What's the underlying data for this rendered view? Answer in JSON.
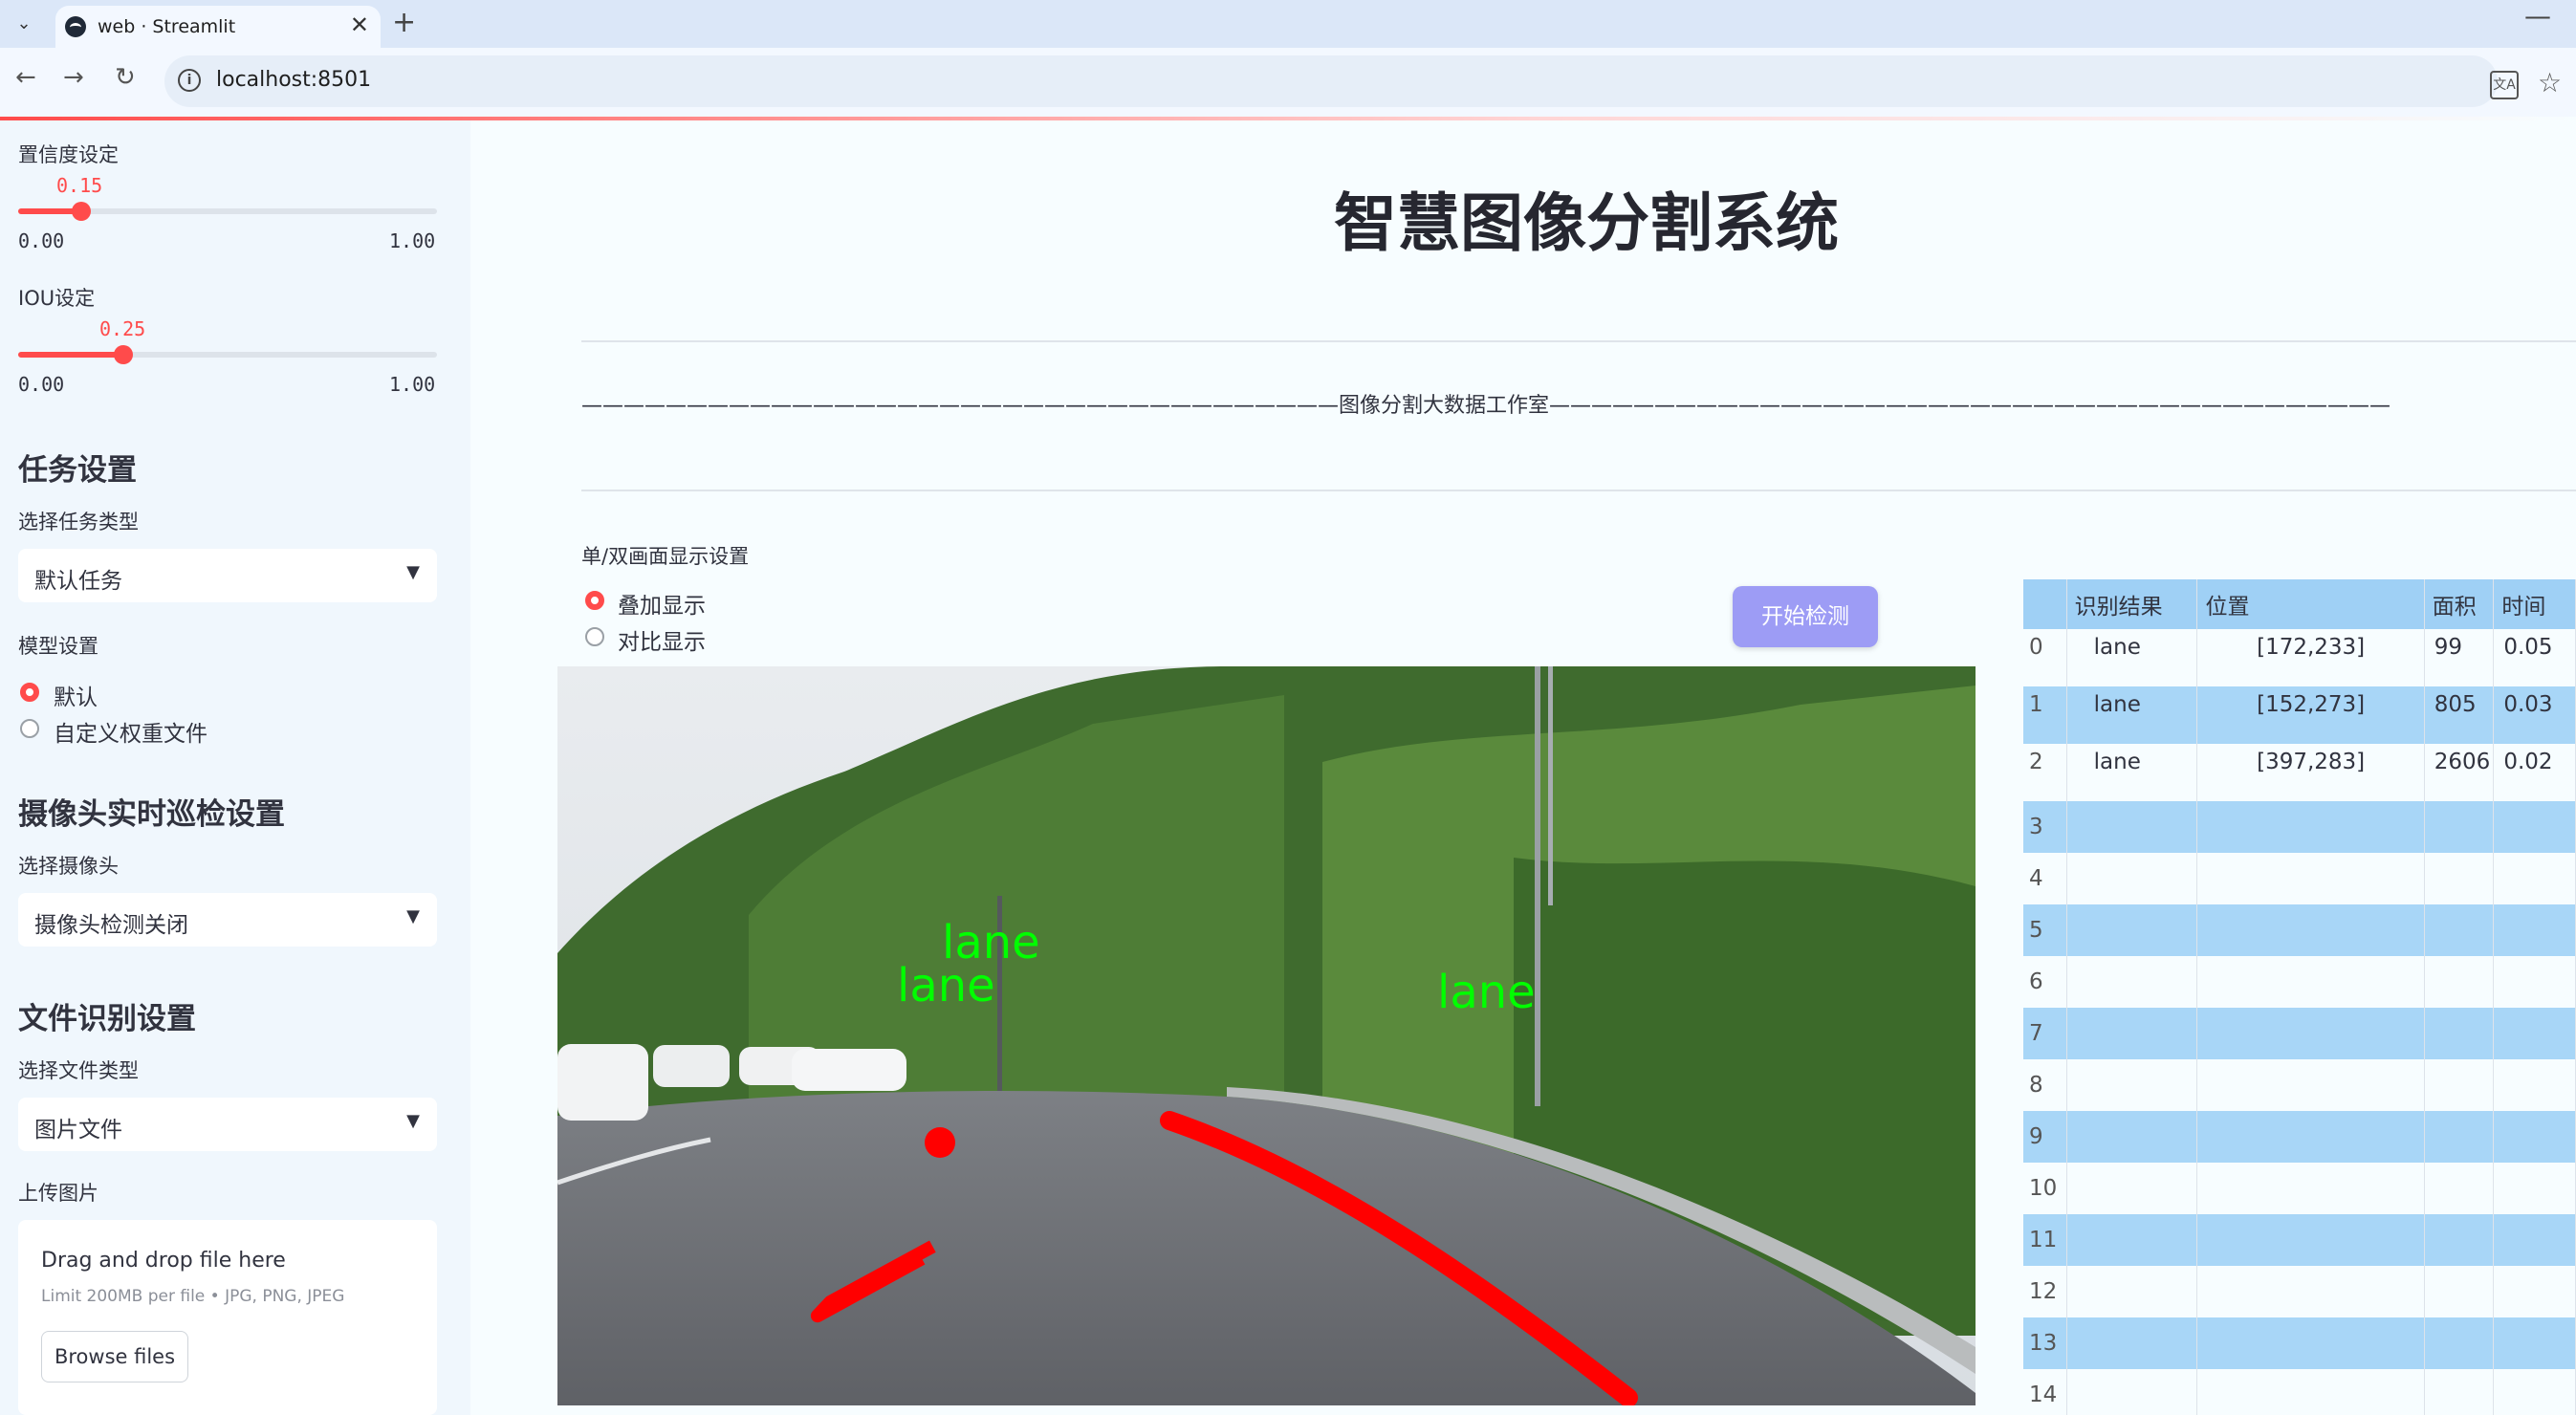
{
  "browser": {
    "tab_title": "web · Streamlit",
    "tab_close": "✕",
    "new_tab": "+",
    "minimize": "—",
    "url": "localhost:8501",
    "nav": {
      "back": "←",
      "forward": "→",
      "reload": "↻"
    }
  },
  "sidebar": {
    "confidence": {
      "label": "置信度设定",
      "value": "0.15",
      "value_fraction": 0.15,
      "min": "0.00",
      "max": "1.00"
    },
    "iou": {
      "label": "IOU设定",
      "value": "0.25",
      "value_fraction": 0.25,
      "min": "0.00",
      "max": "1.00"
    },
    "task_section": {
      "heading": "任务设置",
      "label": "选择任务类型",
      "selected": "默认任务"
    },
    "model_section": {
      "label": "模型设置",
      "options": [
        "默认",
        "自定义权重文件"
      ],
      "selected_index": 0
    },
    "camera_section": {
      "heading": "摄像头实时巡检设置",
      "label": "选择摄像头",
      "selected": "摄像头检测关闭"
    },
    "file_section": {
      "heading": "文件识别设置",
      "label": "选择文件类型",
      "selected": "图片文件"
    },
    "upload": {
      "label": "上传图片",
      "drop_text": "Drag and drop file here",
      "limit_text": "Limit 200MB per file • JPG, PNG, JPEG",
      "browse_label": "Browse files"
    }
  },
  "main": {
    "title": "智慧图像分割系统",
    "studio_line": "————————————————————————————————————图像分割大数据工作室————————————————————————————————————————",
    "display_setting": {
      "label": "单/双画面显示设置",
      "options": [
        "叠加显示",
        "对比显示"
      ],
      "selected_index": 0
    },
    "start_button": "开始检测",
    "detections": [
      "lane",
      "lane",
      "lane"
    ]
  },
  "results_table": {
    "headers": [
      "",
      "识别结果",
      "位置",
      "面积",
      "时间"
    ],
    "rows": [
      [
        "0",
        "lane",
        "[172,233]",
        "99",
        "0.05"
      ],
      [
        "1",
        "lane",
        "[152,273]",
        "805",
        "0.03"
      ],
      [
        "2",
        "lane",
        "[397,283]",
        "2606",
        "0.02"
      ],
      [
        "3",
        "",
        "",
        "",
        ""
      ],
      [
        "4",
        "",
        "",
        "",
        ""
      ],
      [
        "5",
        "",
        "",
        "",
        ""
      ],
      [
        "6",
        "",
        "",
        "",
        ""
      ],
      [
        "7",
        "",
        "",
        "",
        ""
      ],
      [
        "8",
        "",
        "",
        "",
        ""
      ],
      [
        "9",
        "",
        "",
        "",
        ""
      ],
      [
        "10",
        "",
        "",
        "",
        ""
      ],
      [
        "11",
        "",
        "",
        "",
        ""
      ],
      [
        "12",
        "",
        "",
        "",
        ""
      ],
      [
        "13",
        "",
        "",
        "",
        ""
      ],
      [
        "14",
        "",
        "",
        "",
        ""
      ]
    ]
  },
  "colors": {
    "accent": "#ff4b4b",
    "button": "#9d9cf5",
    "table_header": "#9fd0f5",
    "lane_mask": "#ff0000",
    "label_green": "#00ff00"
  }
}
